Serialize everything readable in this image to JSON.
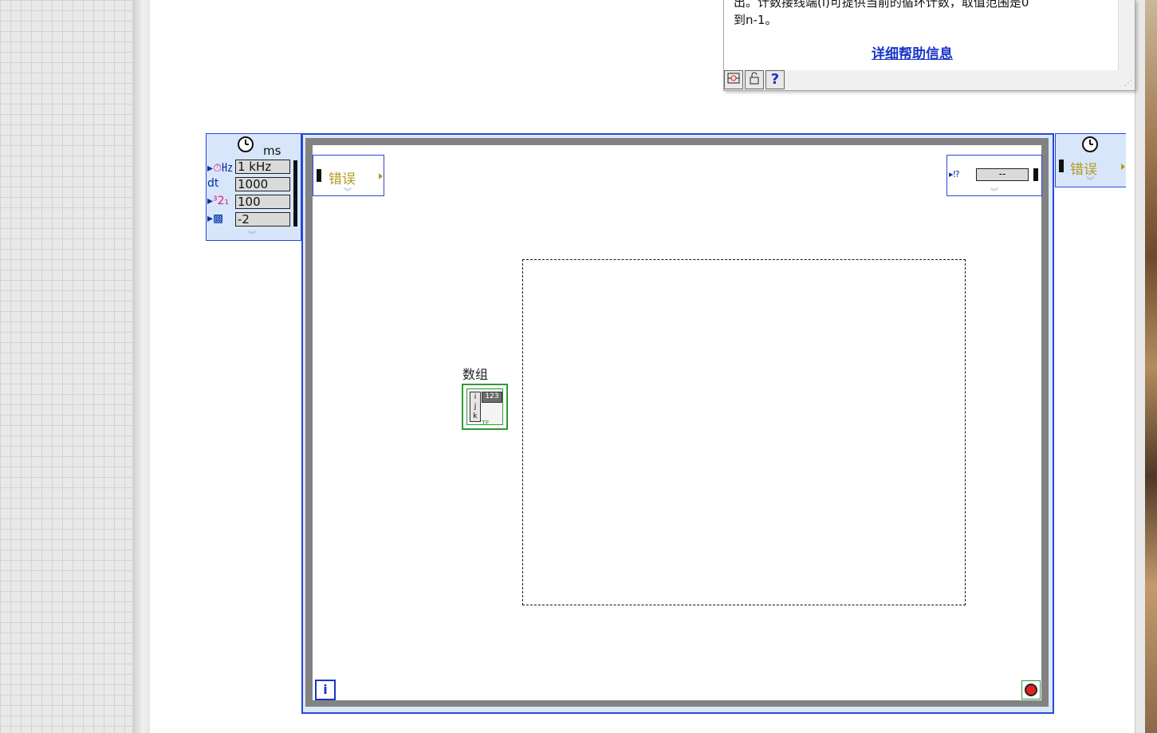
{
  "help_window": {
    "text_line1": "出。计数接线端(i)可提供当前的循环计数，取值范围是0",
    "text_line2": "到n-1。",
    "link": "详细帮助信息",
    "toolbar": [
      "block-diagram-icon",
      "lock-icon",
      "help-icon"
    ],
    "help_glyph": "?"
  },
  "timed_loop": {
    "input_node": {
      "unit": "ms",
      "rows": [
        {
          "icon": "source-clock-icon",
          "value": "1 kHz"
        },
        {
          "icon_text": "dt",
          "value": "1000"
        },
        {
          "icon": "priority-icon",
          "value": "100"
        },
        {
          "icon": "processor-icon",
          "value": "-2"
        }
      ]
    },
    "left_shift_label": "错误",
    "right_shift_field": "--",
    "output_node_label": "错误"
  },
  "array": {
    "label": "数组",
    "index_labels": [
      "i",
      "j",
      "k"
    ],
    "numeric_label": "123",
    "bool_label": "TF"
  },
  "iteration_label": "i",
  "colors": {
    "loop_frame": "#2948d8",
    "error_text": "#b59a1a",
    "terminal_green": "#2e9a35",
    "stop_red": "#e52020"
  }
}
